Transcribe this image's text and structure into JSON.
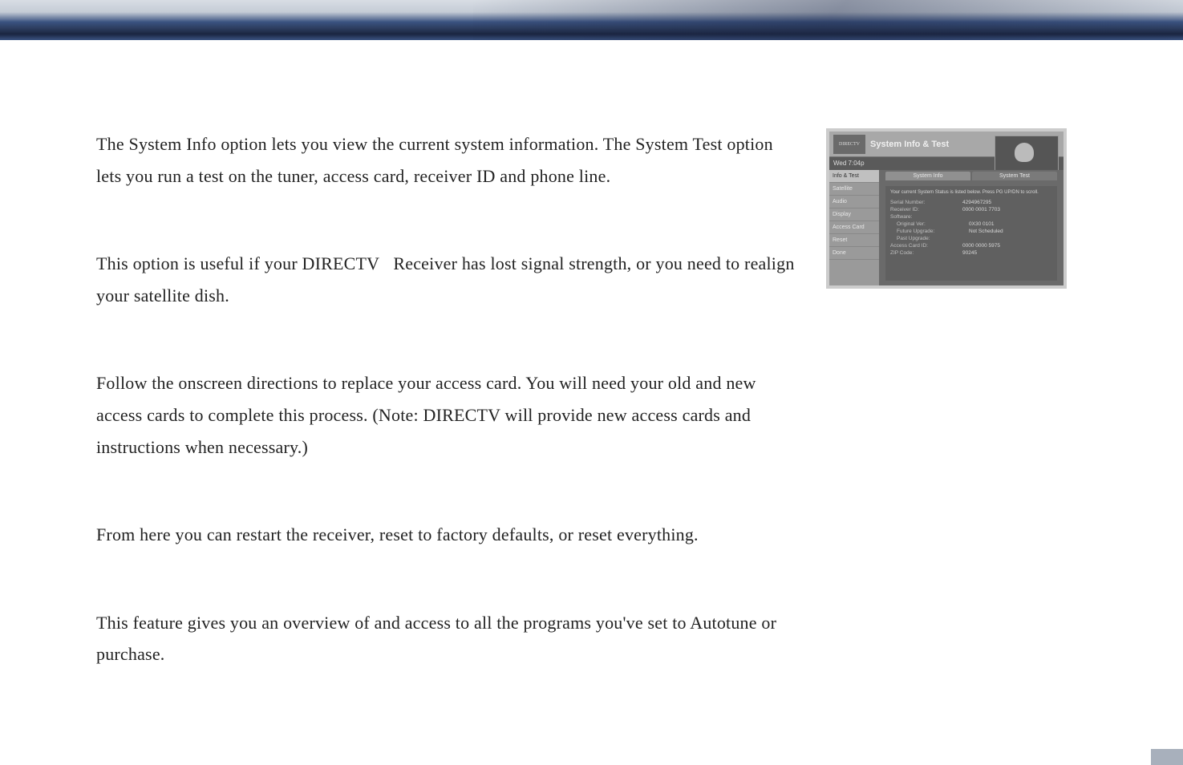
{
  "paragraphs": {
    "p1": "The System Info option lets you view the current system information. The System Test option lets you run a test on the tuner, access card, receiver ID and phone line.",
    "p2": "This option is useful if your DIRECTV   Receiver has lost signal strength, or you need to realign your satellite dish.",
    "p3": "Follow the onscreen directions to replace your access card. You will need your old and new access cards to complete this process. (Note: DIRECTV will provide new access cards and instructions when necessary.)",
    "p4": "From here you can restart the receiver, reset to factory defaults, or reset everything.",
    "p5": "This feature gives you an overview of and access to all the programs you've set to Autotune or purchase."
  },
  "screenshot": {
    "logo_text": "DIRECTV",
    "title": "System Info & Test",
    "time": "Wed 7:04p",
    "sidebar": {
      "items": [
        "Info & Test",
        "Satellite",
        "Audio",
        "Display",
        "Access Card",
        "Reset",
        "Done"
      ]
    },
    "tabs": {
      "left": "System Info",
      "right": "System Test"
    },
    "instruction": "Your current System Status is listed below. Press PG UP/DN to scroll.",
    "rows": {
      "serial_label": "Serial Number:",
      "serial_value": "4294967295",
      "receiver_label": "Receiver ID:",
      "receiver_value": "0000 0001 7703",
      "software_label": "Software:",
      "original_label": "Original Ver:",
      "original_value": "0X30 0101",
      "future_label": "Future Upgrade:",
      "future_value": "Not Scheduled",
      "past_label": "Past Upgrade:",
      "access_label": "Access Card ID:",
      "access_value": "0000 0000 5975",
      "zip_label": "ZIP Code:",
      "zip_value": "90245"
    }
  }
}
